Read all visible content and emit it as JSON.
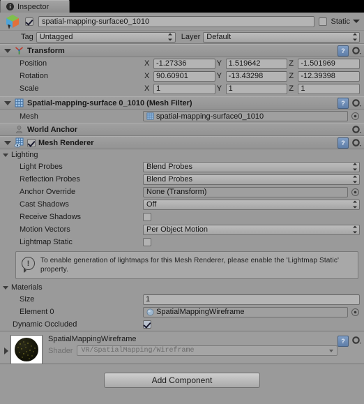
{
  "window": {
    "tab_label": "Inspector",
    "tab_icon": "info-circle-icon"
  },
  "object_header": {
    "enabled": true,
    "icon": "gameobject-cube-icon",
    "name": "spatial-mapping-surface0_1010",
    "static_label": "Static",
    "static_checked": false,
    "tag_label": "Tag",
    "tag_value": "Untagged",
    "layer_label": "Layer",
    "layer_value": "Default"
  },
  "components": [
    {
      "title": "Transform",
      "icon": "transform-axis-icon",
      "expanded": true,
      "rows": [
        {
          "label": "Position",
          "x": "-1.27336",
          "y": "1.519642",
          "z": "-1.501969"
        },
        {
          "label": "Rotation",
          "x": "90.60901",
          "y": "-13.43298",
          "z": "-12.39398"
        },
        {
          "label": "Scale",
          "x": "1",
          "y": "1",
          "z": "1"
        }
      ],
      "axis_labels": [
        "X",
        "Y",
        "Z"
      ]
    },
    {
      "title": "Spatial-mapping-surface 0_1010 (Mesh Filter)",
      "icon": "mesh-filter-grid-icon",
      "expanded": true,
      "mesh_label": "Mesh",
      "mesh_value": "spatial-mapping-surface0_1010"
    },
    {
      "title": "World Anchor",
      "icon": "world-anchor-pin-icon",
      "expanded": false
    },
    {
      "title": "Mesh Renderer",
      "icon": "mesh-renderer-icon",
      "expanded": true,
      "enabled": true
    }
  ],
  "lighting": {
    "section_label": "Lighting",
    "light_probes_label": "Light Probes",
    "light_probes_value": "Blend Probes",
    "reflection_probes_label": "Reflection Probes",
    "reflection_probes_value": "Blend Probes",
    "anchor_override_label": "Anchor Override",
    "anchor_override_value": "None (Transform)",
    "cast_shadows_label": "Cast Shadows",
    "cast_shadows_value": "Off",
    "receive_shadows_label": "Receive Shadows",
    "receive_shadows_checked": false,
    "motion_vectors_label": "Motion Vectors",
    "motion_vectors_value": "Per Object Motion",
    "lightmap_static_label": "Lightmap Static",
    "lightmap_static_checked": false
  },
  "help_box": {
    "icon": "warning-bubble-icon",
    "text": "To enable generation of lightmaps for this Mesh Renderer, please enable the 'Lightmap Static' property."
  },
  "materials": {
    "section_label": "Materials",
    "size_label": "Size",
    "size_value": "1",
    "element_label": "Element 0",
    "element_value": "SpatialMappingWireframe",
    "dynamic_occluded_label": "Dynamic Occluded",
    "dynamic_occluded_checked": true
  },
  "material_footer": {
    "name": "SpatialMappingWireframe",
    "shader_label": "Shader",
    "shader_value": "VR/SpatialMapping/Wireframe",
    "preview_icon": "material-sphere-preview"
  },
  "footer": {
    "add_component_label": "Add Component"
  },
  "icons": {
    "help": "?",
    "gear": "gear-icon",
    "warning": "!"
  },
  "colors": {
    "background": "#9a9a9a",
    "field": "#b4b4b4",
    "header": "#a0a0a0",
    "accent_blue": "#5f7ea8"
  }
}
